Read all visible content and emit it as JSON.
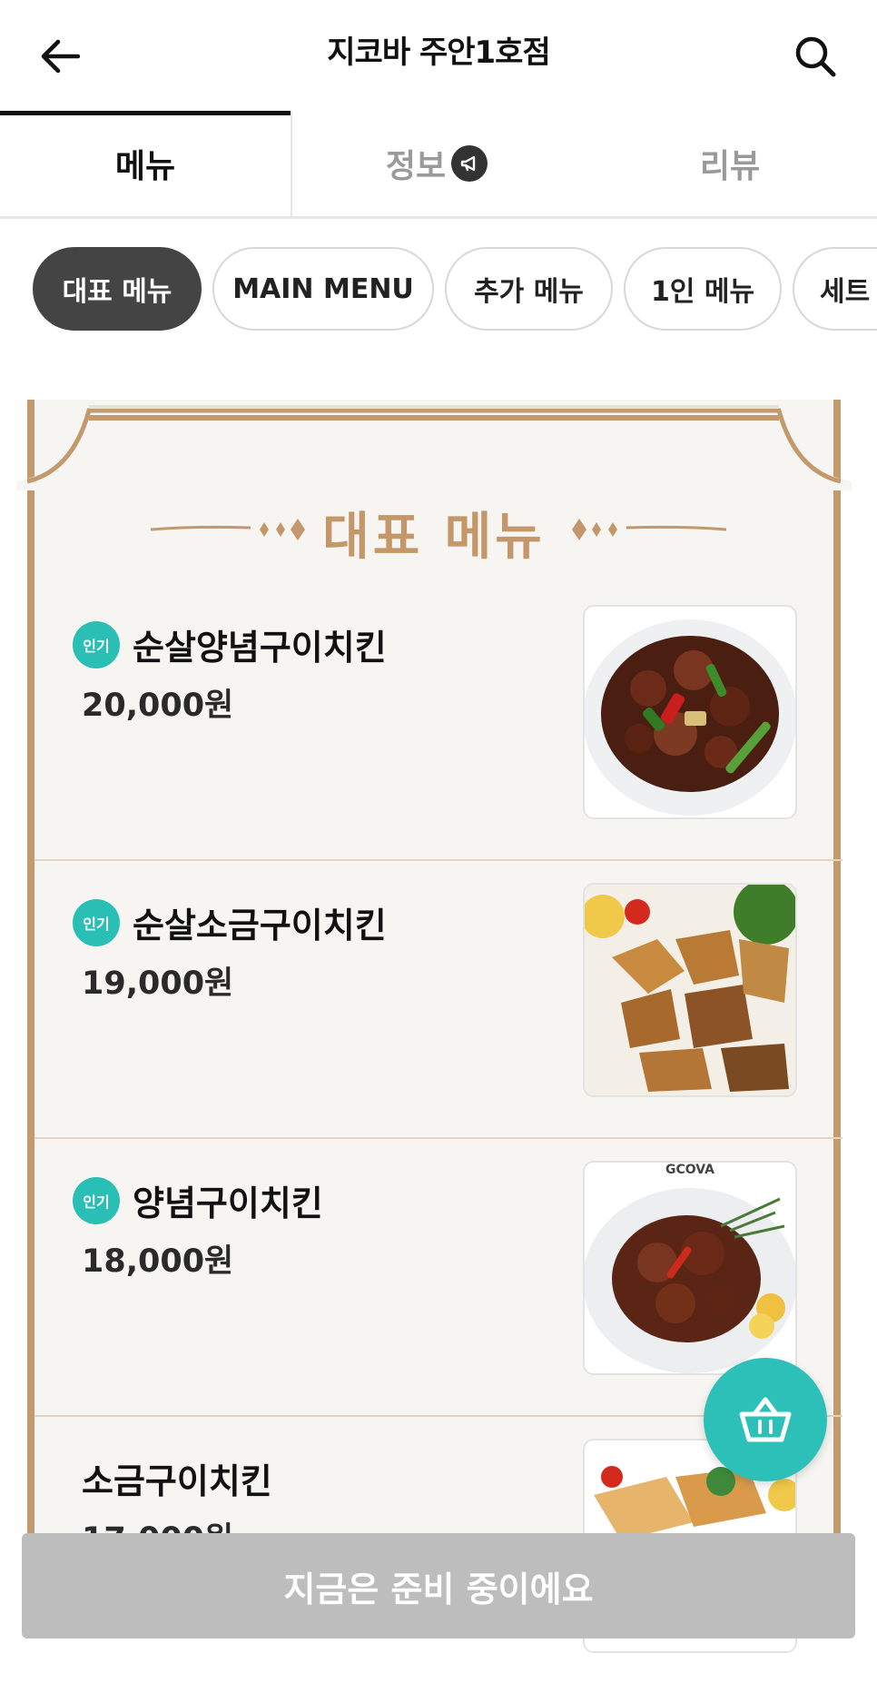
{
  "header": {
    "title": "지코바 주안1호점",
    "back_icon": "arrow-left-icon",
    "search_icon": "search-icon"
  },
  "tabs": [
    {
      "label": "메뉴",
      "active": true
    },
    {
      "label": "정보",
      "active": false,
      "icon": "megaphone-icon"
    },
    {
      "label": "리뷰",
      "active": false
    }
  ],
  "categories": [
    {
      "label": "대표 메뉴",
      "active": true
    },
    {
      "label": "MAIN MENU",
      "active": false
    },
    {
      "label": "추가 메뉴",
      "active": false
    },
    {
      "label": "1인 메뉴",
      "active": false
    },
    {
      "label": "세트",
      "active": false
    }
  ],
  "section": {
    "title": "대표 메뉴"
  },
  "menu_items": [
    {
      "badge": "인기",
      "name": "순살양념구이치킨",
      "price": "20,000원",
      "image_photo": "spicy-grilled-chicken"
    },
    {
      "badge": "인기",
      "name": "순살소금구이치킨",
      "price": "19,000원",
      "image_photo": "salt-grilled-chicken"
    },
    {
      "badge": "인기",
      "name": "양념구이치킨",
      "price": "18,000원",
      "image_photo": "sauced-grilled-chicken",
      "image_watermark": "GCOVA"
    },
    {
      "badge": "",
      "name": "소금구이치킨",
      "price": "17,000원",
      "image_photo": "salt-grilled-chicken-2"
    }
  ],
  "cart": {
    "icon": "basket-icon"
  },
  "bottom_bar": {
    "label": "지금은 준비 중이에요"
  },
  "colors": {
    "accent_teal": "#2cc0b8",
    "paper_border": "#c39a6e",
    "section_title": "#c4976a",
    "disabled_bar": "#bdbdbd"
  }
}
